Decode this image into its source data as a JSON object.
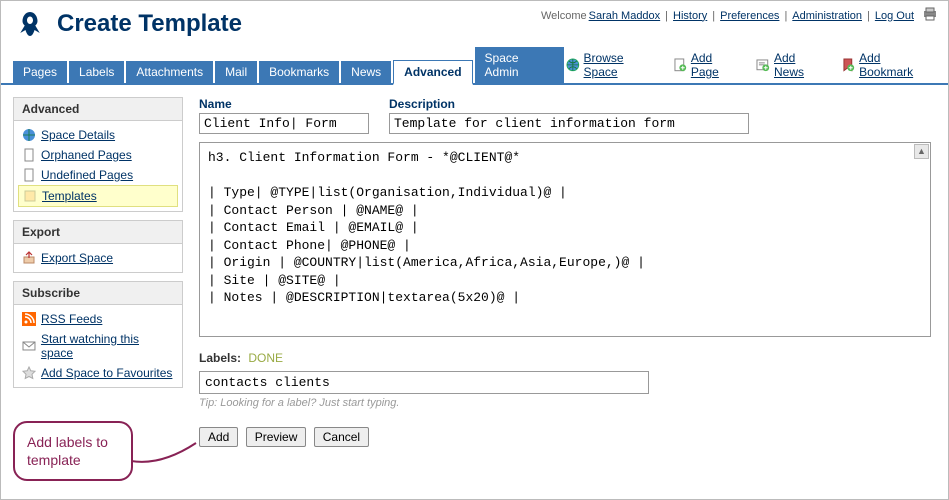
{
  "header": {
    "title": "Create Template",
    "welcome_prefix": "Welcome ",
    "user": "Sarah Maddox",
    "links": [
      "History",
      "Preferences",
      "Administration",
      "Log Out"
    ]
  },
  "tabs": [
    "Pages",
    "Labels",
    "Attachments",
    "Mail",
    "Bookmarks",
    "News",
    "Advanced",
    "Space Admin"
  ],
  "tabs_selected": 6,
  "actions": {
    "browse": "Browse Space",
    "add_page": "Add Page",
    "add_news": "Add News",
    "add_bookmark": "Add Bookmark"
  },
  "sidebar": {
    "advanced": {
      "title": "Advanced",
      "items": [
        {
          "label": "Space Details",
          "icon": "globe"
        },
        {
          "label": "Orphaned Pages",
          "icon": "page"
        },
        {
          "label": "Undefined Pages",
          "icon": "page"
        },
        {
          "label": "Templates",
          "icon": "template",
          "selected": true
        }
      ]
    },
    "export": {
      "title": "Export",
      "items": [
        {
          "label": "Export Space",
          "icon": "export"
        }
      ]
    },
    "subscribe": {
      "title": "Subscribe",
      "items": [
        {
          "label": "RSS Feeds",
          "icon": "rss"
        },
        {
          "label": "Start watching this space",
          "icon": "mail"
        },
        {
          "label": "Add Space to Favourites",
          "icon": "star"
        }
      ]
    }
  },
  "form": {
    "name_label": "Name",
    "name_value": "Client Info| Form",
    "desc_label": "Description",
    "desc_value": "Template for client information form",
    "body": "h3. Client Information Form - *@CLIENT@*\n\n| Type| @TYPE|list(Organisation,Individual)@ |\n| Contact Person | @NAME@ |\n| Contact Email | @EMAIL@ |\n| Contact Phone| @PHONE@ |\n| Origin | @COUNTRY|list(America,Africa,Asia,Europe,)@ |\n| Site | @SITE@ |\n| Notes | @DESCRIPTION|textarea(5x20)@ |",
    "labels_label": "Labels:",
    "labels_done": "DONE",
    "labels_value": "contacts clients",
    "tip": "Tip: Looking for a label? Just start typing.",
    "buttons": {
      "add": "Add",
      "preview": "Preview",
      "cancel": "Cancel"
    }
  },
  "callout": "Add labels to template"
}
